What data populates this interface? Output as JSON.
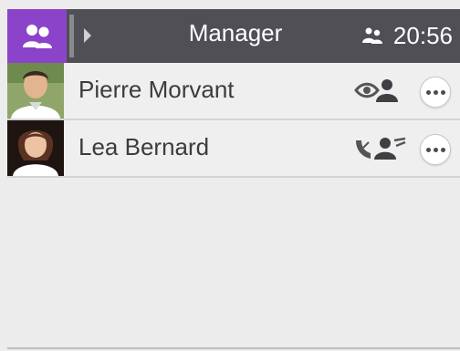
{
  "header": {
    "title": "Manager",
    "time": "20:56",
    "app_icon": "users-icon",
    "status_icon": "users-small-icon"
  },
  "contacts": [
    {
      "name": "Pierre Morvant",
      "presence_icon": "eye-user-icon"
    },
    {
      "name": "Lea Bernard",
      "presence_icon": "phone-user-icon"
    }
  ],
  "colors": {
    "accent": "#8b43c9",
    "header_bg": "#4f4f55",
    "list_bg": "#efefef"
  }
}
